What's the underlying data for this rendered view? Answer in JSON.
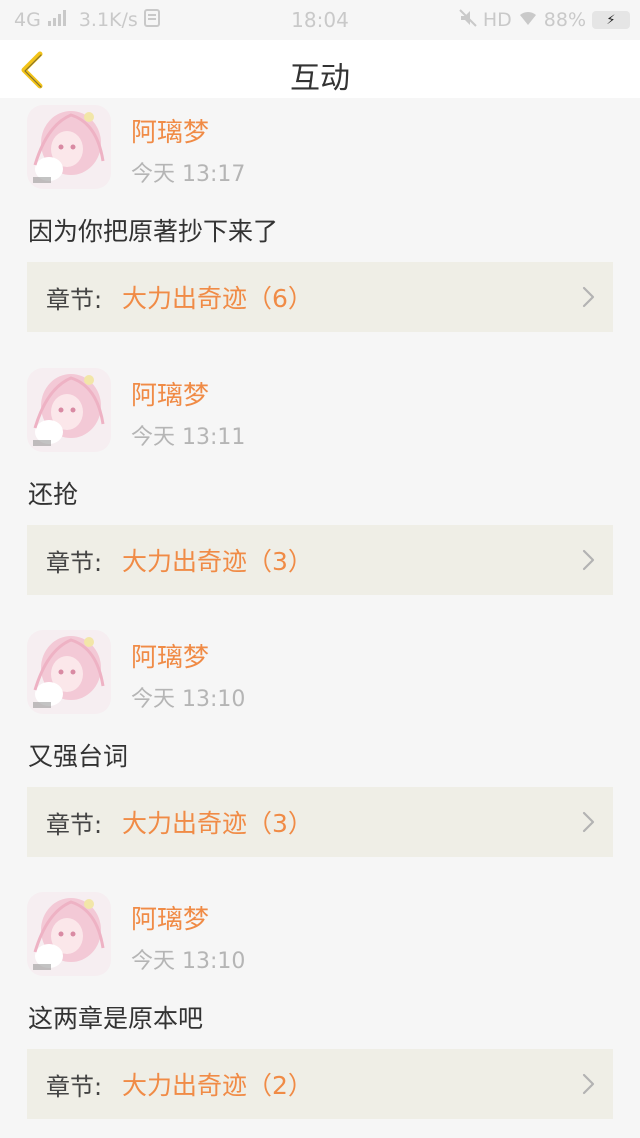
{
  "status_bar": {
    "network": "4G",
    "speed": "3.1K/s",
    "time": "18:04",
    "hd": "HD",
    "battery": "88%"
  },
  "header": {
    "title": "互动",
    "back_icon": "chevron-left-icon"
  },
  "posts": [
    {
      "username": "阿璃梦",
      "time": "今天 13:17",
      "comment": "因为你把原著抄下来了",
      "chapter_label": "章节:",
      "chapter_title": "大力出奇迹（6）"
    },
    {
      "username": "阿璃梦",
      "time": "今天 13:11",
      "comment": "还抢",
      "chapter_label": "章节:",
      "chapter_title": "大力出奇迹（3）"
    },
    {
      "username": "阿璃梦",
      "time": "今天 13:10",
      "comment": "又强台词",
      "chapter_label": "章节:",
      "chapter_title": "大力出奇迹（3）"
    },
    {
      "username": "阿璃梦",
      "time": "今天 13:10",
      "comment": "这两章是原本吧",
      "chapter_label": "章节:",
      "chapter_title": "大力出奇迹（2）"
    }
  ],
  "colors": {
    "accent": "#f08b46",
    "back_arrow": "#f2c318",
    "chapter_bg": "#efeee6"
  }
}
